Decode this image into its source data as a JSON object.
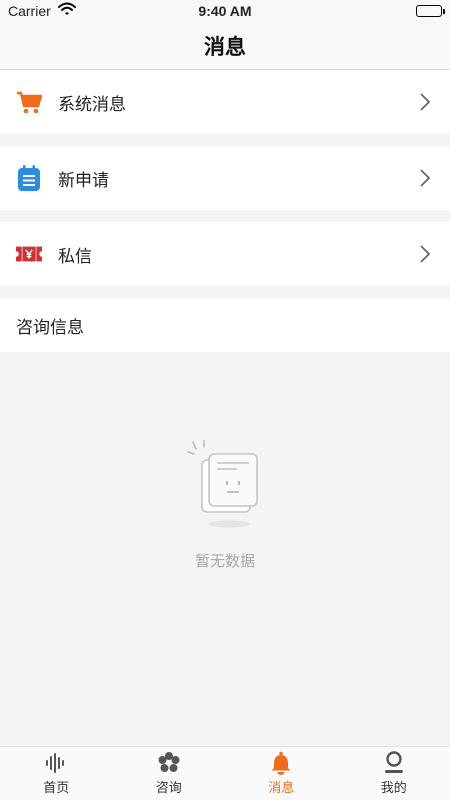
{
  "status_bar": {
    "carrier": "Carrier",
    "time": "9:40 AM"
  },
  "nav": {
    "title": "消息"
  },
  "menu": [
    {
      "label": "系统消息",
      "icon": "shopping-cart-icon",
      "color": "#f26b1d"
    },
    {
      "label": "新申请",
      "icon": "notepad-icon",
      "color": "#2b8ce0"
    },
    {
      "label": "私信",
      "icon": "yen-ticket-icon",
      "color": "#d03030"
    }
  ],
  "section": {
    "title": "咨询信息"
  },
  "empty": {
    "text": "暂无数据"
  },
  "tabs": [
    {
      "label": "首页",
      "icon": "sound-bars-icon"
    },
    {
      "label": "咨询",
      "icon": "flower-icon"
    },
    {
      "label": "消息",
      "icon": "bell-icon",
      "active": true
    },
    {
      "label": "我的",
      "icon": "user-icon"
    }
  ],
  "colors": {
    "accent": "#f26b1d",
    "background": "#f4f4f4"
  }
}
